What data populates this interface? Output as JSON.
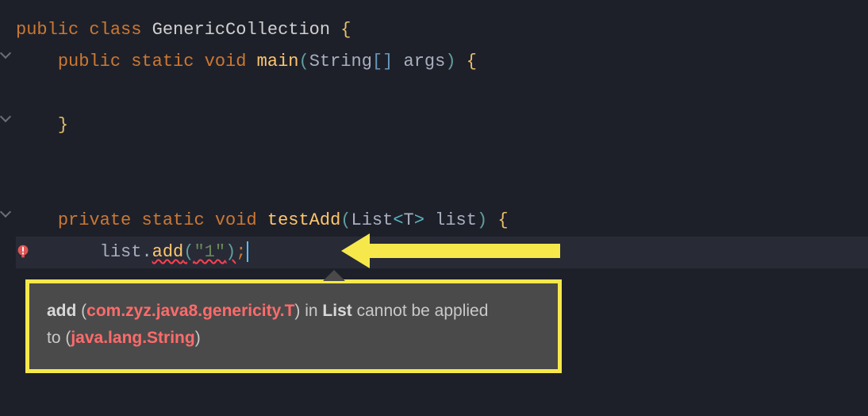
{
  "code": {
    "l1": {
      "kw1": "public",
      "kw2": "class",
      "cls": "GenericCollection",
      "brace": "{"
    },
    "l2": {
      "kw1": "public",
      "kw2": "static",
      "kw3": "void",
      "method": "main",
      "type": "String",
      "brackets": "[]",
      "arg": "args",
      "brace": "{"
    },
    "l3": {
      "brace": "}"
    },
    "l4": {
      "kw1": "private",
      "kw2": "static",
      "kw3": "void",
      "method": "testAdd",
      "type1": "List",
      "generic": "T",
      "arg": "list",
      "brace": "{"
    },
    "l5": {
      "var": "list",
      "method": "add",
      "str": "\"1\"",
      "semicolon": ";"
    }
  },
  "tooltip": {
    "bold1": "add",
    "err1": "com.zyz.java8.genericity.T",
    "plain1": " (",
    "plain2": ") in ",
    "bold2": "List",
    "plain3": " cannot be applied",
    "plain4": "to   (",
    "err2": "java.lang.String",
    "plain5": ")"
  }
}
